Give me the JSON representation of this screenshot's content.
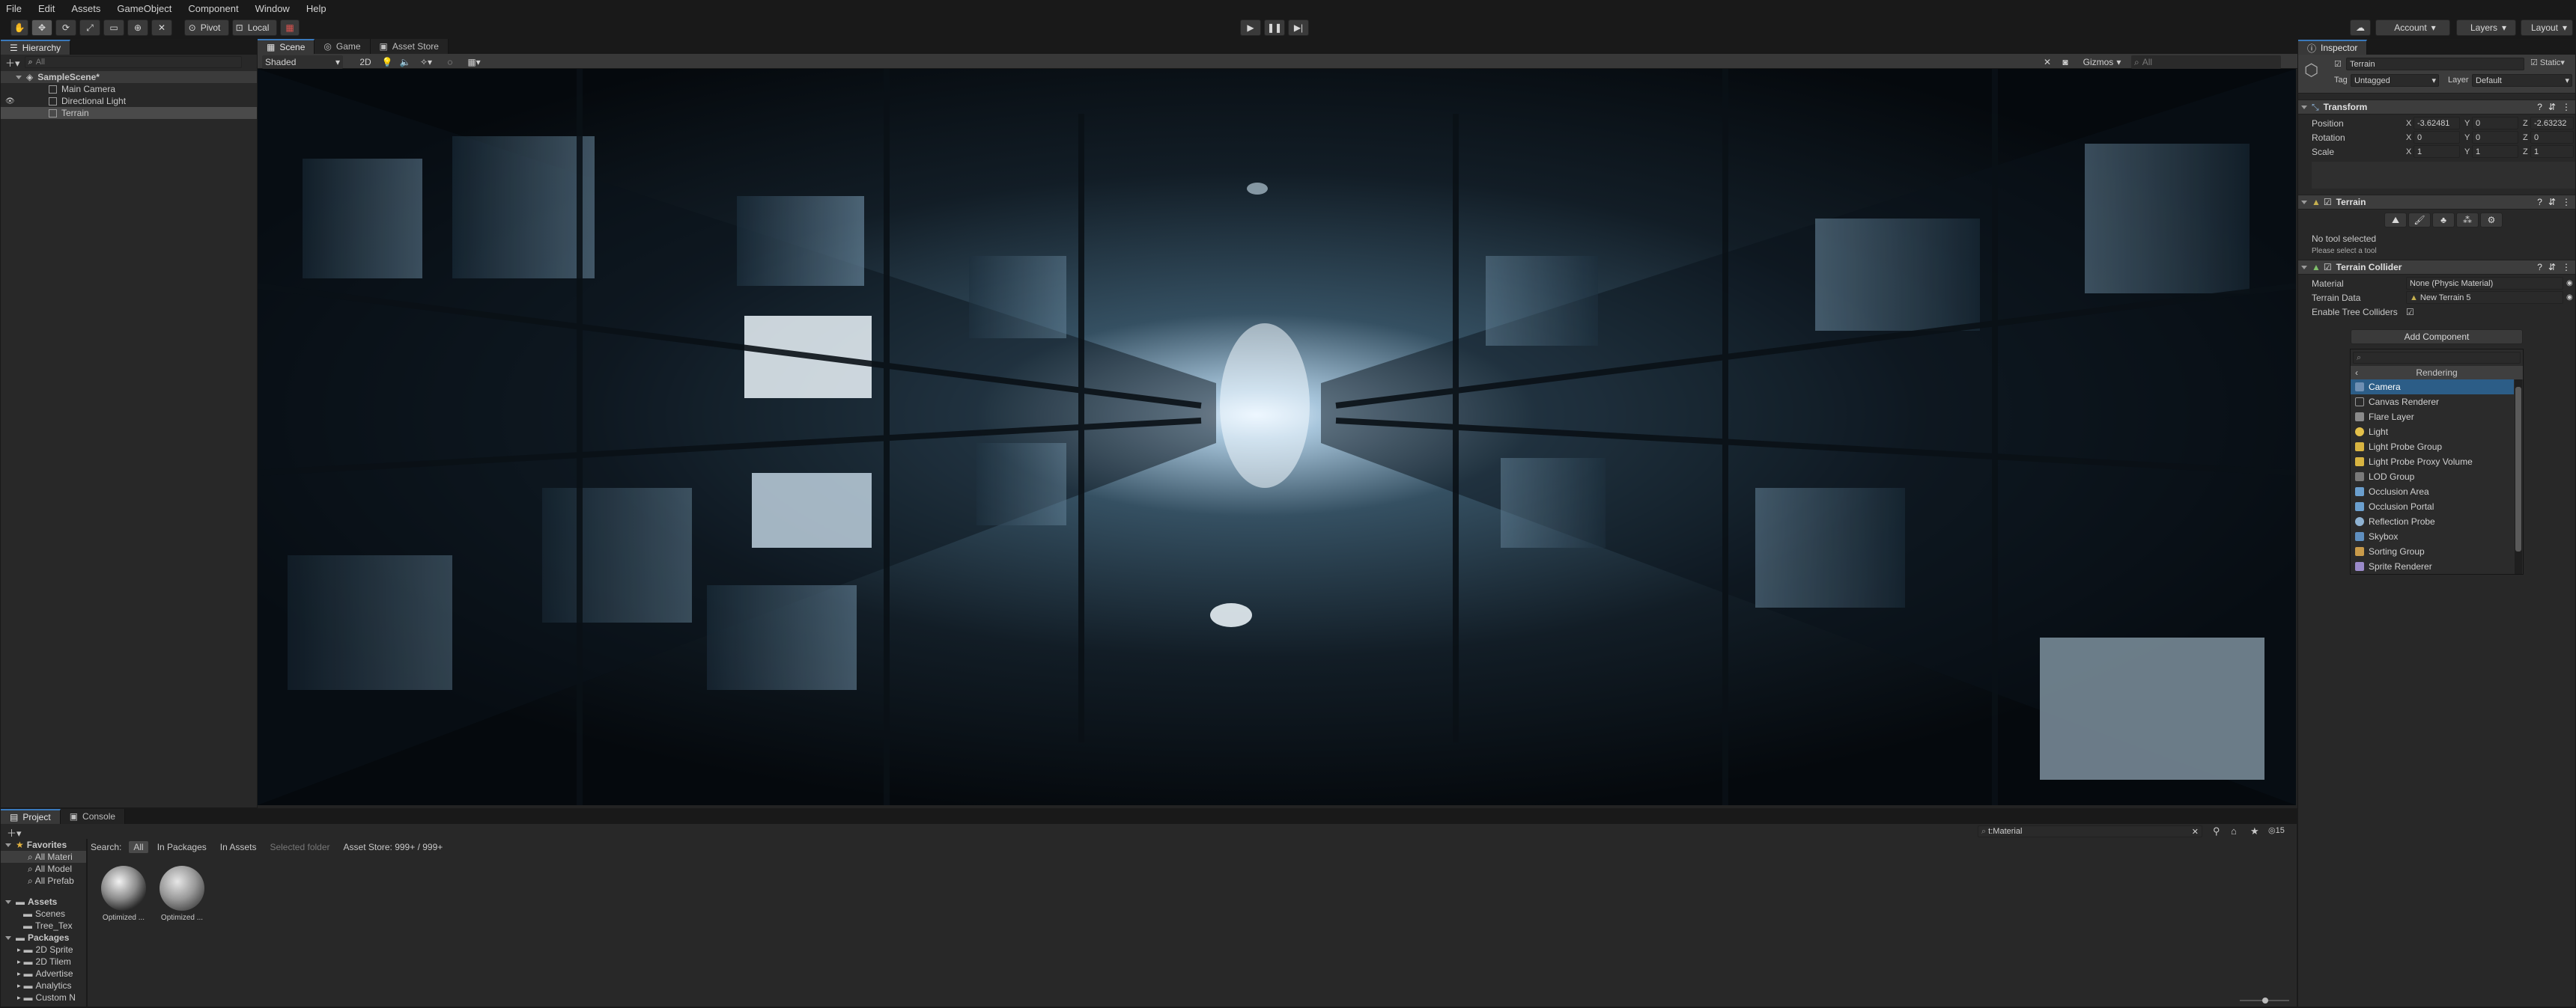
{
  "menu": [
    "File",
    "Edit",
    "Assets",
    "GameObject",
    "Component",
    "Window",
    "Help"
  ],
  "toolbar": {
    "pivot_label": "Pivot",
    "local_label": "Local",
    "account_label": "Account",
    "layers_label": "Layers",
    "layout_label": "Layout"
  },
  "hierarchy": {
    "tab": "Hierarchy",
    "search_placeholder": "All",
    "scene": "SampleScene*",
    "items": [
      "Main Camera",
      "Directional Light",
      "Terrain"
    ]
  },
  "scene_view": {
    "tabs": [
      "Scene",
      "Game",
      "Asset Store"
    ],
    "shading_mode": "Shaded",
    "mode_2d": "2D",
    "gizmos_label": "Gizmos",
    "search_placeholder": "All"
  },
  "inspector": {
    "tab": "Inspector",
    "object_name": "Terrain",
    "static_label": "Static",
    "tag_label": "Tag",
    "tag_value": "Untagged",
    "layer_label": "Layer",
    "layer_value": "Default",
    "transform": {
      "title": "Transform",
      "position_label": "Position",
      "rotation_label": "Rotation",
      "scale_label": "Scale",
      "position": [
        "-3.62481",
        "0",
        "-2.63232"
      ],
      "rotation": [
        "0",
        "0",
        "0"
      ],
      "scale": [
        "1",
        "1",
        "1"
      ]
    },
    "terrain": {
      "title": "Terrain",
      "no_tool": "No tool selected",
      "hint": "Please select a tool"
    },
    "collider": {
      "title": "Terrain Collider",
      "material_label": "Material",
      "material_value": "None (Physic Material)",
      "data_label": "Terrain Data",
      "data_value": "New Terrain 5",
      "trees_label": "Enable Tree Colliders"
    },
    "add_component_label": "Add Component",
    "dropdown": {
      "category": "Rendering",
      "items": [
        "Camera",
        "Canvas Renderer",
        "Flare Layer",
        "Light",
        "Light Probe Group",
        "Light Probe Proxy Volume",
        "LOD Group",
        "Occlusion Area",
        "Occlusion Portal",
        "Reflection Probe",
        "Skybox",
        "Sorting Group",
        "Sprite Renderer"
      ]
    }
  },
  "project": {
    "tabs": [
      "Project",
      "Console"
    ],
    "search_value": "t:Material",
    "count": "15",
    "search_label": "Search:",
    "filters": [
      "All",
      "In Packages",
      "In Assets",
      "Selected folder",
      "Asset Store: 999+ / 999+"
    ],
    "favorites_label": "Favorites",
    "favorites": [
      "All Materi",
      "All Model",
      "All Prefab"
    ],
    "assets_label": "Assets",
    "assets": [
      "Scenes",
      "Tree_Tex"
    ],
    "packages_label": "Packages",
    "packages": [
      "2D Sprite",
      "2D Tilem",
      "Advertise",
      "Analytics",
      "Custom N"
    ],
    "results": [
      "Optimized ...",
      "Optimized ..."
    ]
  },
  "colors": {
    "accent": "#3a79bb",
    "selection": "#2c5d87",
    "panel": "#282828"
  }
}
